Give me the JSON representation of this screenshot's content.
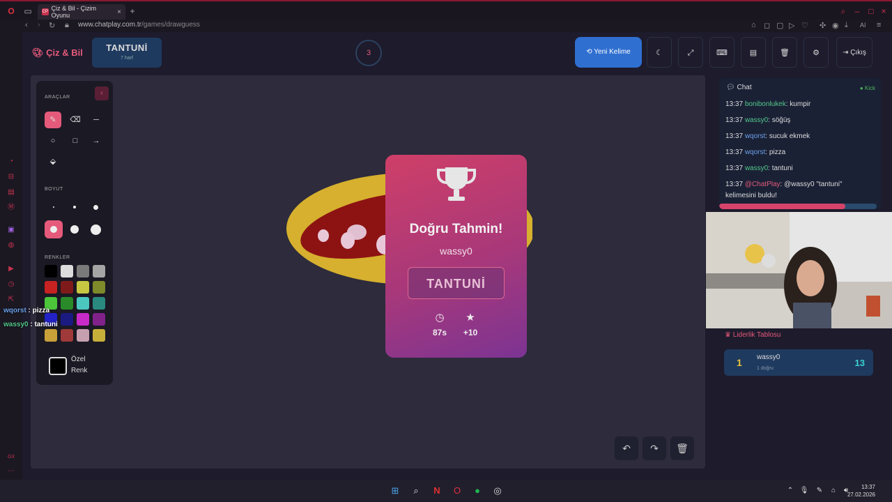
{
  "browser": {
    "tab_title": "Çiz & Bil - Çizim Oyunu",
    "tab_favicon": "CP",
    "url_host": "www.chatplay.com.tr",
    "url_path": "/games/drawguess",
    "ai_label": "AI"
  },
  "header": {
    "logo": "Çiz & Bil",
    "word": "TANTUNİ",
    "word_length": "7 harf",
    "timer": "3",
    "new_word_label": "Yeni Kelime",
    "exit_label": "Çıkış"
  },
  "tools": {
    "tools_label": "ARAÇLAR",
    "size_label": "BOYUT",
    "colors_label": "RENKLER",
    "custom_color_label": "Özel Renk",
    "colors": [
      "#000000",
      "#dcdcdc",
      "#7a7a7a",
      "#a5a5a5",
      "#c72222",
      "#7f1a1a",
      "#c7c742",
      "#7f8a2a",
      "#4cc53a",
      "#2a8a2a",
      "#4bc7c0",
      "#2a8a80",
      "#2222c7",
      "#1a1a80",
      "#c72ac7",
      "#80228a",
      "#c7a03a",
      "#a03a3a",
      "#c7a0b0",
      "#c7b03a"
    ]
  },
  "result_card": {
    "title": "Doğru Tahmin!",
    "winner": "wassy0",
    "word": "TANTUNİ",
    "time": "87s",
    "points": "+10"
  },
  "chat": {
    "title": "Chat",
    "platform": "Kick",
    "messages": [
      {
        "time": "13:37",
        "user": "bonibonlukek",
        "text": ": kumpir"
      },
      {
        "time": "13:37",
        "user": "wassy0",
        "text": ": söğüş"
      },
      {
        "time": "13:37",
        "user": "wqorst",
        "text": ": sucuk ekmek"
      },
      {
        "time": "13:37",
        "user": "wqorst",
        "text": ": pizza"
      },
      {
        "time": "13:37",
        "user": "wassy0",
        "text": ": tantuni"
      },
      {
        "time": "13:37",
        "user": "@ChatPlay",
        "text": ": @wassy0 \"tantuni\" kelimesini buldu!"
      }
    ]
  },
  "leaderboard": {
    "title": "Liderlik Tablosu",
    "rows": [
      {
        "rank": "1",
        "name": "wassy0",
        "sub": "1 doğru",
        "score": "13"
      }
    ]
  },
  "stream_overlay": [
    {
      "user": "wqorst",
      "text": " : pizza"
    },
    {
      "user": "wassy0",
      "text": " : tantuni"
    }
  ],
  "taskbar": {
    "time": "13:37",
    "date": "27.02.2026"
  }
}
